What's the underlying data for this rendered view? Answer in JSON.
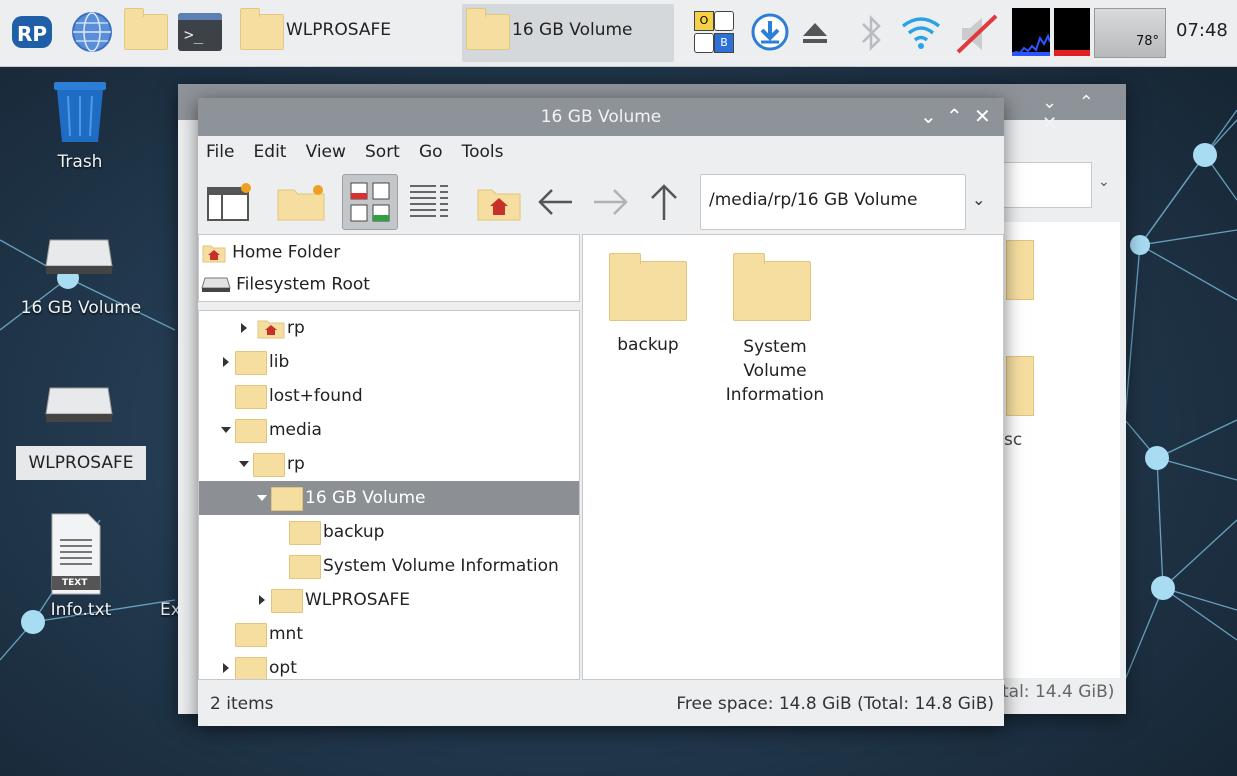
{
  "taskbar": {
    "windows": [
      {
        "label": "WLPROSAFE"
      },
      {
        "label": "16 GB Volume"
      }
    ],
    "kbd_top": "O",
    "kbd_bottom": "B",
    "temperature": "78°",
    "clock": "07:48"
  },
  "desktop": {
    "icons": [
      {
        "label": "Trash"
      },
      {
        "label": "16 GB Volume"
      },
      {
        "label": "WLPROSAFE"
      },
      {
        "label": "Info.txt"
      }
    ],
    "text_badge": "TEXT",
    "partial_label": "Ex"
  },
  "back_window": {
    "partial_folder_label": "sc",
    "partial_status": "tal: 14.4 GiB)"
  },
  "window": {
    "title": "16 GB Volume",
    "menu": [
      "File",
      "Edit",
      "View",
      "Sort",
      "Go",
      "Tools"
    ],
    "path": "/media/rp/16 GB Volume",
    "places": [
      {
        "label": "Home Folder"
      },
      {
        "label": "Filesystem Root"
      }
    ],
    "tree": [
      {
        "label": "rp"
      },
      {
        "label": "lib"
      },
      {
        "label": "lost+found"
      },
      {
        "label": "media"
      },
      {
        "label": "rp"
      },
      {
        "label": "16 GB Volume"
      },
      {
        "label": "backup"
      },
      {
        "label": "System Volume Information"
      },
      {
        "label": "WLPROSAFE"
      },
      {
        "label": "mnt"
      },
      {
        "label": "opt"
      }
    ],
    "files": [
      {
        "name": "backup"
      },
      {
        "name": "System Volume Information"
      }
    ],
    "status_items": "2 items",
    "status_free": "Free space: 14.8 GiB (Total: 14.8 GiB)"
  }
}
